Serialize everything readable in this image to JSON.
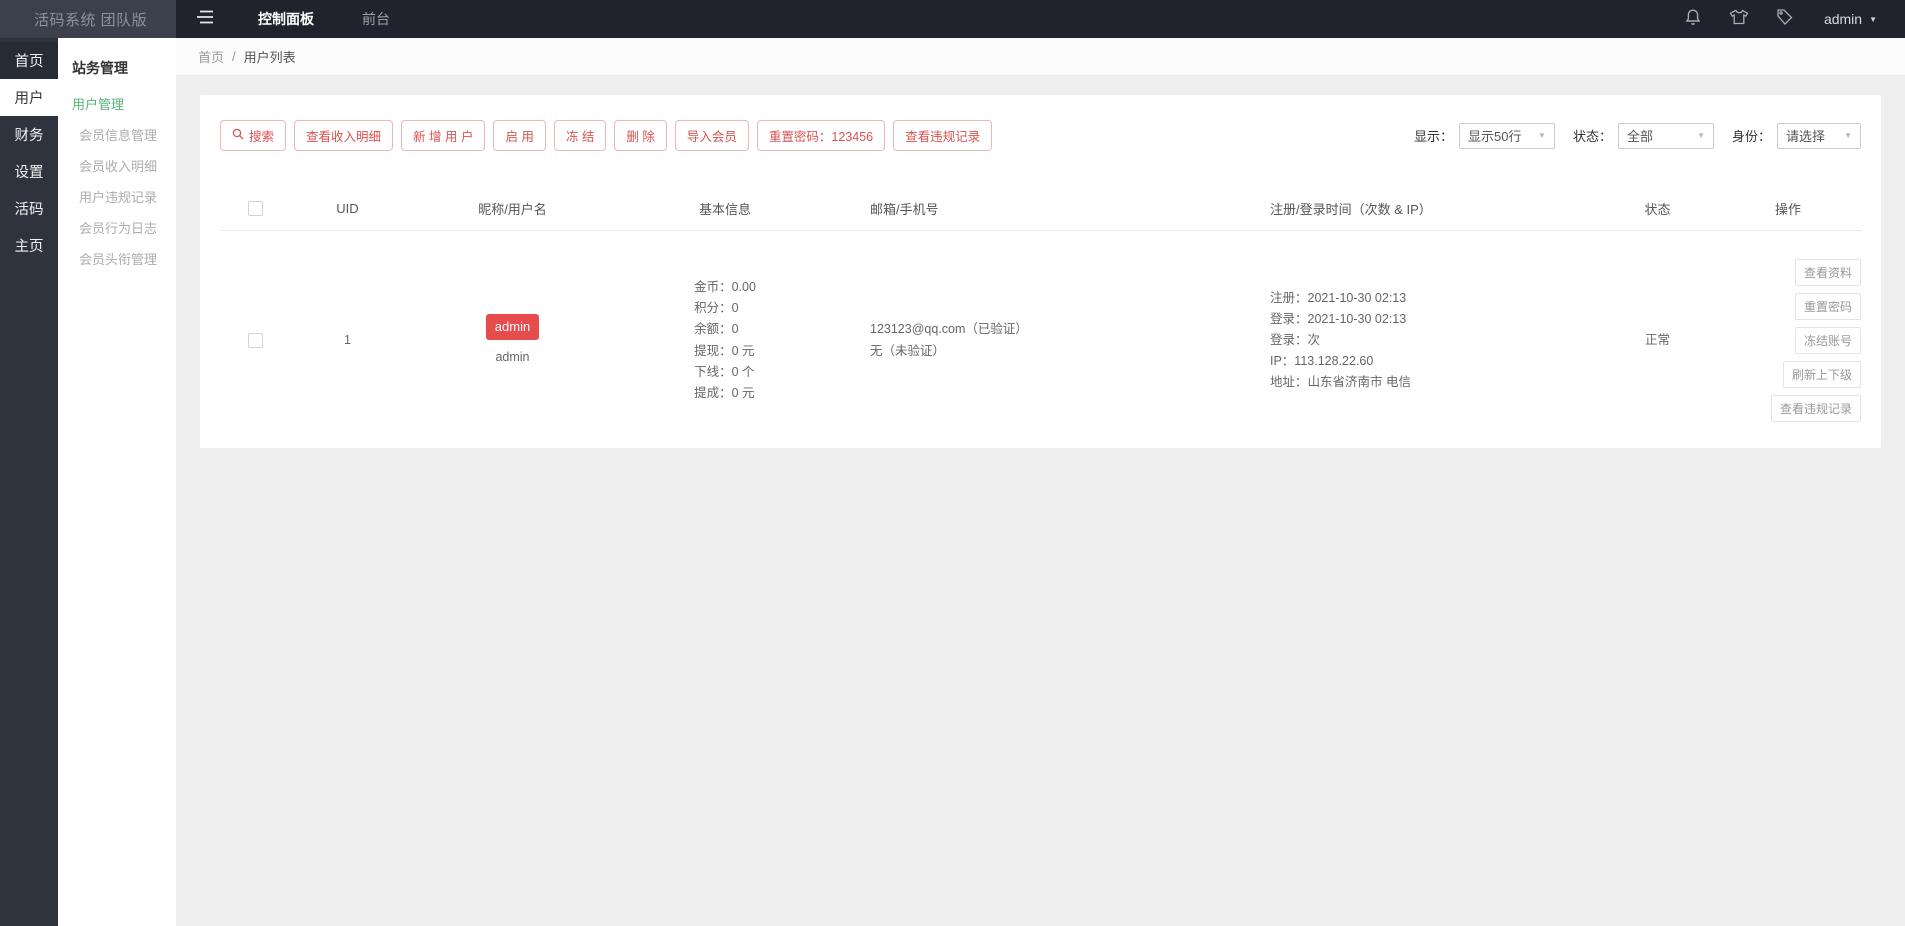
{
  "topbar": {
    "logo": "活码系统 团队版",
    "nav": [
      {
        "label": "控制面板"
      },
      {
        "label": "前台"
      }
    ],
    "user": "admin"
  },
  "rail": {
    "items": [
      {
        "label": "首页"
      },
      {
        "label": "用户"
      },
      {
        "label": "财务"
      },
      {
        "label": "设置"
      },
      {
        "label": "活码"
      },
      {
        "label": "主页"
      }
    ]
  },
  "submenu": {
    "header": "站务管理",
    "items": [
      {
        "label": "用户管理"
      },
      {
        "label": "会员信息管理"
      },
      {
        "label": "会员收入明细"
      },
      {
        "label": "用户违规记录"
      },
      {
        "label": "会员行为日志"
      },
      {
        "label": "会员头衔管理"
      }
    ]
  },
  "breadcrumb": {
    "home": "首页",
    "separator": "/",
    "current": "用户列表"
  },
  "toolbar": {
    "buttons": [
      {
        "label": "搜索"
      },
      {
        "label": "查看收入明细"
      },
      {
        "label": "新 增 用 户"
      },
      {
        "label": "启 用"
      },
      {
        "label": "冻 结"
      },
      {
        "label": "删 除"
      },
      {
        "label": "导入会员"
      },
      {
        "label": "重置密码：123456"
      },
      {
        "label": "查看违规记录"
      }
    ]
  },
  "filters": [
    {
      "label": "显示：",
      "value": "显示50行"
    },
    {
      "label": "状态：",
      "value": "全部"
    },
    {
      "label": "身份：",
      "value": "请选择"
    }
  ],
  "table": {
    "headers": [
      "UID",
      "昵称/用户名",
      "基本信息",
      "邮箱/手机号",
      "注册/登录时间（次数 & IP）",
      "状态",
      "操作"
    ],
    "row": {
      "uid": "1",
      "badge": "admin",
      "username": "admin",
      "basic": [
        "金币：0.00",
        "积分：0",
        "余额：0",
        "提现：0 元",
        "下线：0 个",
        "提成：0 元"
      ],
      "contact": [
        "123123@qq.com（已验证）",
        "无（未验证）"
      ],
      "register": [
        "注册：2021-10-30 02:13",
        "登录：2021-10-30 02:13",
        "登录：次",
        "IP：113.128.22.60",
        "地址：山东省济南市 电信"
      ],
      "status": "正常",
      "actions": [
        {
          "label": "查看资料"
        },
        {
          "label": "重置密码"
        },
        {
          "label": "冻结账号"
        },
        {
          "label": "刷新上下级"
        },
        {
          "label": "查看违规记录"
        }
      ]
    }
  },
  "colors": {
    "navbar": "#20232b",
    "logo_block": "#3b404c",
    "rail": "#2f333d",
    "accent_red": "#d9534f",
    "badge_red": "#e74c4c",
    "active_green": "#56b576"
  }
}
